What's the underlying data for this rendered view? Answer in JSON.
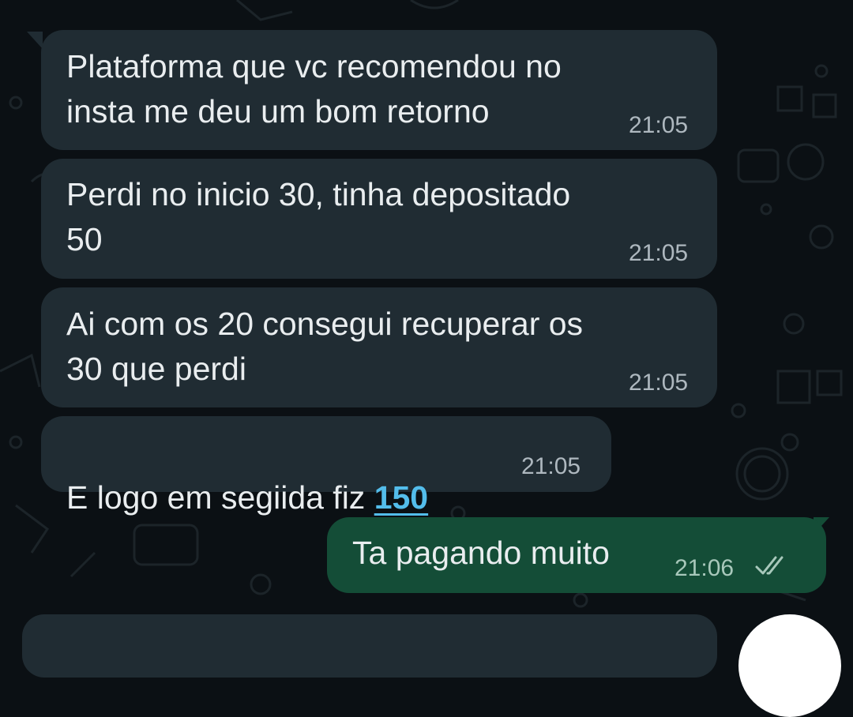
{
  "messages": [
    {
      "direction": "incoming",
      "text": "Plataforma que vc recomendou no\ninsta me deu um bom retorno",
      "time": "21:05"
    },
    {
      "direction": "incoming",
      "text": "Perdi no inicio 30, tinha depositado\n50",
      "time": "21:05"
    },
    {
      "direction": "incoming",
      "text": "Ai com os 20 consegui recuperar os\n30 que perdi",
      "time": "21:05"
    },
    {
      "direction": "incoming",
      "text": "E logo em segiida fiz ",
      "link": "150",
      "time": "21:05"
    },
    {
      "direction": "outgoing",
      "text": "Ta pagando muito",
      "time": "21:06",
      "status": "read",
      "status_icon": "double-check-icon"
    }
  ],
  "colors": {
    "background": "#0b1014",
    "incoming_bubble": "#202c33",
    "outgoing_bubble": "#144d37",
    "text": "#e9edef",
    "link": "#53bdeb",
    "timestamp": "#aeb8bf"
  }
}
